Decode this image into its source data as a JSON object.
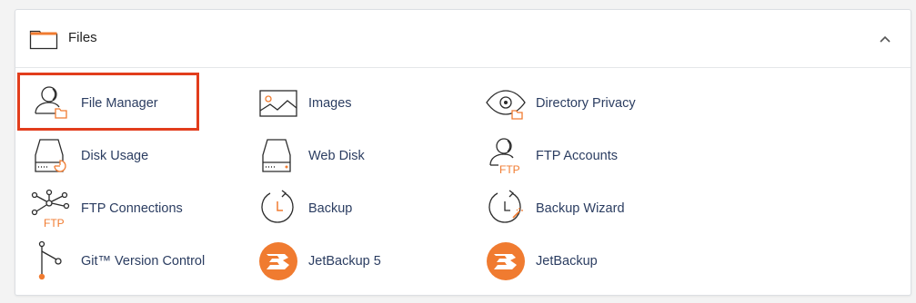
{
  "section": {
    "title": "Files",
    "icon": "folder-icon",
    "collapse_icon": "chevron-up-icon"
  },
  "items": [
    {
      "label": "File Manager",
      "icon": "file-manager-icon"
    },
    {
      "label": "Images",
      "icon": "images-icon"
    },
    {
      "label": "Directory Privacy",
      "icon": "directory-privacy-icon"
    },
    {
      "label": "Disk Usage",
      "icon": "disk-usage-icon"
    },
    {
      "label": "Web Disk",
      "icon": "web-disk-icon"
    },
    {
      "label": "FTP Accounts",
      "icon": "ftp-accounts-icon"
    },
    {
      "label": "FTP Connections",
      "icon": "ftp-connections-icon"
    },
    {
      "label": "Backup",
      "icon": "backup-icon"
    },
    {
      "label": "Backup Wizard",
      "icon": "backup-wizard-icon"
    },
    {
      "label": "Git™ Version Control",
      "icon": "git-icon"
    },
    {
      "label": "JetBackup 5",
      "icon": "jetbackup-5-icon"
    },
    {
      "label": "JetBackup",
      "icon": "jetbackup-icon"
    }
  ],
  "icon_text": {
    "ftp": "FTP"
  },
  "colors": {
    "accent": "#f07b30",
    "highlight": "#e23d1c",
    "link": "#2b3d61",
    "icon_stroke": "#2b2b2b"
  }
}
